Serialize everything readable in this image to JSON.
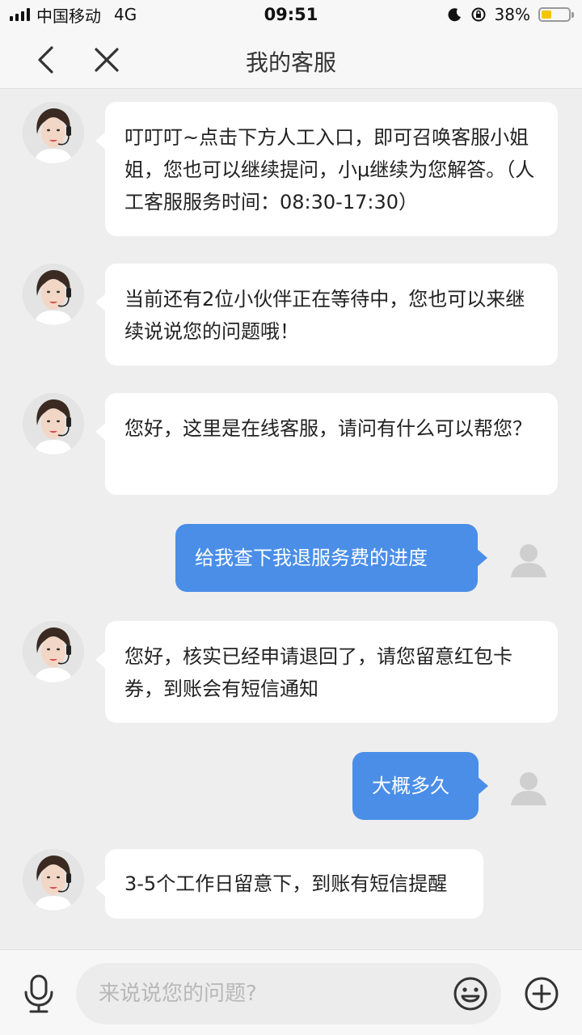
{
  "status_bar": {
    "carrier": "中国移动",
    "network": "4G",
    "time": "09:51",
    "battery_text": "38%",
    "battery_level": 0.38
  },
  "nav": {
    "title": "我的客服",
    "back_icon": "chevron-left-icon",
    "close_icon": "close-icon"
  },
  "messages": [
    {
      "from": "agent",
      "text": "叮叮叮~点击下方人工入口，即可召唤客服小姐姐，您也可以继续提问，小μ继续为您解答。（人工客服服务时间：08:30-17:30）"
    },
    {
      "from": "agent",
      "text": "当前还有2位小伙伴正在等待中，您也可以来继续说说您的问题哦！"
    },
    {
      "from": "agent",
      "text": "您好，这里是在线客服，请问有什么可以帮您？"
    },
    {
      "from": "user",
      "text": "给我查下我退服务费的进度"
    },
    {
      "from": "agent",
      "text": "您好，核实已经申请退回了，请您留意红包卡券，到账会有短信通知"
    },
    {
      "from": "user",
      "text": "大概多久"
    },
    {
      "from": "agent",
      "text": "3-5个工作日留意下，到账有短信提醒"
    }
  ],
  "input": {
    "placeholder": "来说说您的问题?",
    "mic_icon": "microphone-icon",
    "emoji_icon": "smiley-icon",
    "plus_icon": "plus-circle-icon"
  },
  "colors": {
    "user_bubble": "#4a8ee8",
    "agent_bubble": "#ffffff",
    "background": "#eeeeee"
  }
}
